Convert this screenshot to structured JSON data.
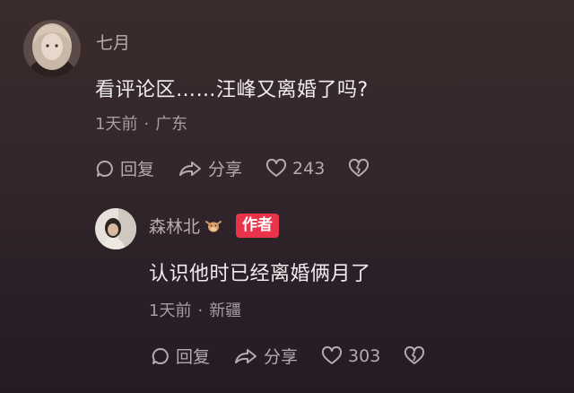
{
  "comment": {
    "username": "七月",
    "text": "看评论区……汪峰又离婚了吗?",
    "time": "1天前",
    "location": "广东",
    "reply_label": "回复",
    "share_label": "分享",
    "like_count": "243"
  },
  "reply": {
    "username": "森林北",
    "author_badge": "作者",
    "text": "认识他时已经离婚俩月了",
    "time": "1天前",
    "location": "新疆",
    "reply_label": "回复",
    "share_label": "分享",
    "like_count": "303"
  },
  "separator": "·",
  "colors": {
    "author_badge": "#e8334a",
    "background": "#33262b"
  }
}
